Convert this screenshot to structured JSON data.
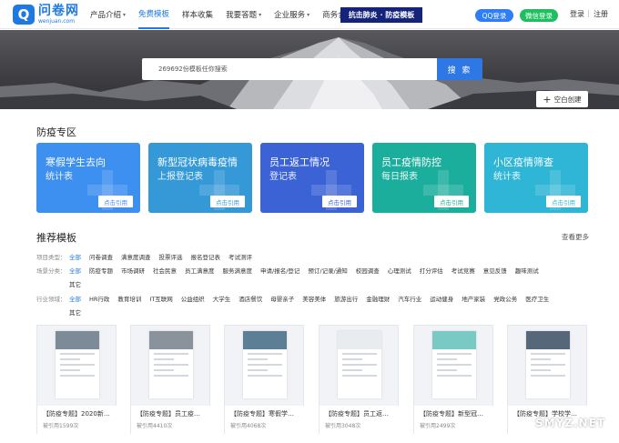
{
  "header": {
    "logo_cn": "问卷网",
    "logo_en": "wenjuan.com",
    "nav": [
      {
        "label": "产品介绍",
        "caret": true,
        "active": false
      },
      {
        "label": "免费模板",
        "caret": false,
        "active": true
      },
      {
        "label": "样本收集",
        "caret": false,
        "active": false
      },
      {
        "label": "我要答题",
        "caret": true,
        "active": false
      },
      {
        "label": "企业服务",
        "caret": true,
        "active": false
      },
      {
        "label": "商务合作",
        "caret": false,
        "active": false
      }
    ],
    "promo": "抗击肺炎 · 防疫模板",
    "qq_login": "QQ登录",
    "wechat_login": "微信登录",
    "login": "登录",
    "separator": "|",
    "register": "注册"
  },
  "hero": {
    "search_placeholder": "269692份模板任你搜索",
    "search_button": "搜 索",
    "blank_create": "空白创建"
  },
  "epidemic": {
    "title": "防疫专区",
    "cards": [
      {
        "title": "寒假学生去向",
        "subtitle": "统计表",
        "button": "点击引用",
        "color": "#3d8ff0"
      },
      {
        "title": "新型冠状病毒疫情",
        "subtitle": "上报登记表",
        "button": "点击引用",
        "color": "#3599d8"
      },
      {
        "title": "员工返工情况",
        "subtitle": "登记表",
        "button": "点击引用",
        "color": "#3c63d6"
      },
      {
        "title": "员工疫情防控",
        "subtitle": "每日报表",
        "button": "点击引用",
        "color": "#1cae9c"
      },
      {
        "title": "小区疫情筛查",
        "subtitle": "统计表",
        "button": "点击引用",
        "color": "#2fb6d6"
      }
    ]
  },
  "recommend": {
    "title": "推荐模板",
    "more": "查看更多",
    "filters": [
      {
        "label": "项目类型：",
        "options": [
          "全部",
          "问卷调查",
          "满意度调查",
          "投票评选",
          "报名登记表",
          "考试测评"
        ],
        "active": 0
      },
      {
        "label": "场景分类：",
        "options": [
          "全部",
          "防疫专题",
          "市场调研",
          "社会民意",
          "员工满意度",
          "服务满意度",
          "申请/报名/登记",
          "预订/记录/通知",
          "校园调查",
          "心理测试",
          "打分评估",
          "考试竞赛",
          "意见反馈",
          "趣味测试"
        ],
        "active": 0
      },
      {
        "label": "",
        "options": [
          "其它"
        ],
        "active": -1
      },
      {
        "label": "行业领域：",
        "options": [
          "全部",
          "HR行政",
          "教育培训",
          "IT互联网",
          "公益组织",
          "大学生",
          "酒店餐饮",
          "母婴亲子",
          "美容美体",
          "旅游出行",
          "金融理财",
          "汽车行业",
          "运动健身",
          "地产家装",
          "党政公务",
          "医疗卫生"
        ],
        "active": 0
      },
      {
        "label": "",
        "options": [
          "其它"
        ],
        "active": -1
      }
    ],
    "templates": [
      {
        "name": "【防疫专题】2020新…",
        "count": "被引用1599次",
        "img": "#7d8b99"
      },
      {
        "name": "【防疫专题】员工疫…",
        "count": "被引用4410次",
        "img": "#8a939c"
      },
      {
        "name": "【防疫专题】寒假学…",
        "count": "被引用4068次",
        "img": "#5d7f96"
      },
      {
        "name": "【防疫专题】员工返…",
        "count": "被引用3048次",
        "img": "#e9ecef"
      },
      {
        "name": "【防疫专题】新型冠…",
        "count": "被引用2499次",
        "img": "#79c9c4"
      },
      {
        "name": "【防疫专题】学校学…",
        "count": "",
        "img": "#56677a"
      }
    ]
  },
  "watermark": "SMYZ.NET"
}
